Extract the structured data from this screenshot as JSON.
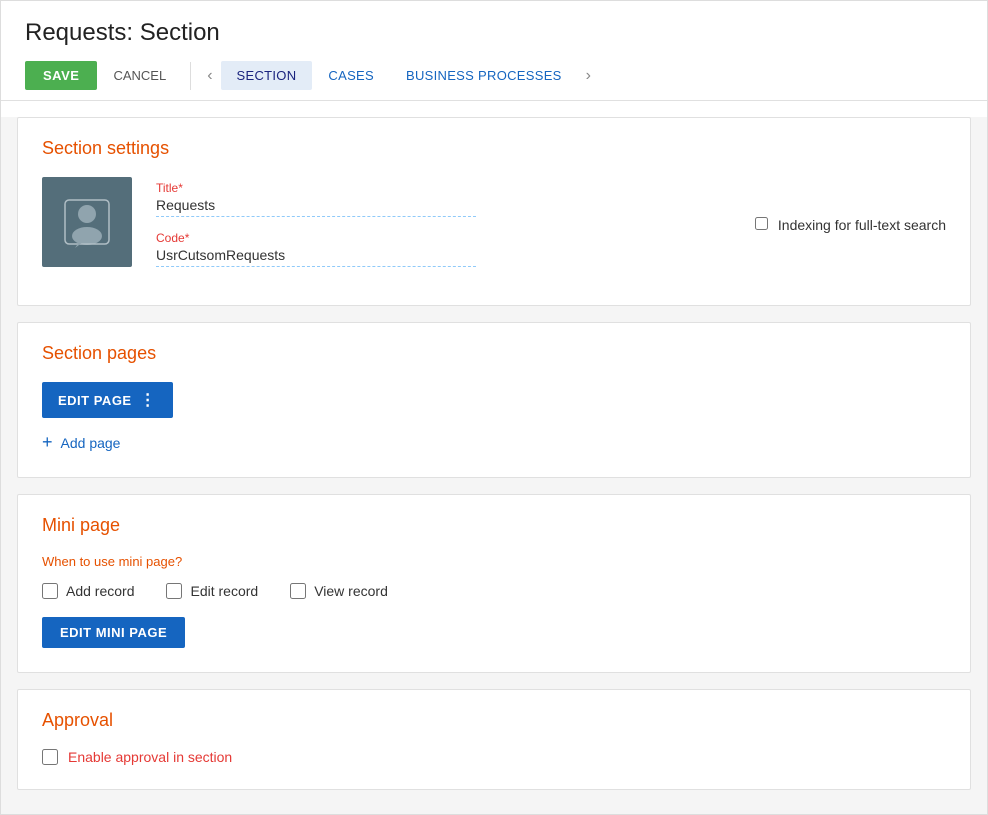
{
  "header": {
    "title": "Requests: Section",
    "save_label": "SAVE",
    "cancel_label": "CANCEL"
  },
  "tabs": [
    {
      "id": "section",
      "label": "SECTION",
      "active": true
    },
    {
      "id": "cases",
      "label": "CASES",
      "active": false
    },
    {
      "id": "business_processes",
      "label": "BUSINESS PROCESSES",
      "active": false
    }
  ],
  "section_settings": {
    "heading": "Section settings",
    "title_label": "Title*",
    "title_value": "Requests",
    "code_label": "Code*",
    "code_value": "UsrCutsomRequests",
    "indexing_label": "Indexing for full-text search"
  },
  "section_pages": {
    "heading": "Section pages",
    "edit_page_label": "EDIT PAGE",
    "edit_page_menu_icon": "⋮",
    "add_page_label": "Add page"
  },
  "mini_page": {
    "heading": "Mini page",
    "when_to_use": "When to use mini page?",
    "add_record_label": "Add record",
    "edit_record_label": "Edit record",
    "view_record_label": "View record",
    "edit_mini_page_label": "EDIT MINI PAGE"
  },
  "approval": {
    "heading": "Approval",
    "enable_label_prefix": "Enable approval ",
    "enable_label_accent": "in section",
    "enable_label_suffix": ""
  }
}
